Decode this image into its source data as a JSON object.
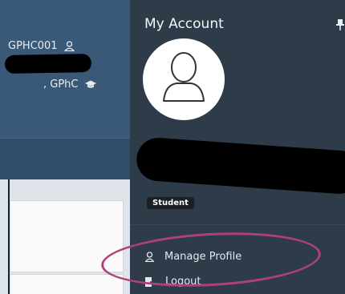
{
  "header": {
    "user_id": "GPHC001",
    "user_role": ", GPhC"
  },
  "account_panel": {
    "title": "My Account",
    "badge": "Student",
    "menu": [
      {
        "label": "Manage Profile",
        "icon": "user-icon"
      },
      {
        "label": "Logout",
        "icon": "logout-icon"
      }
    ]
  },
  "colors": {
    "panel_bg": "#2e3b48",
    "header_bg": "#3a5877",
    "highlight_ring": "#b13f78"
  }
}
